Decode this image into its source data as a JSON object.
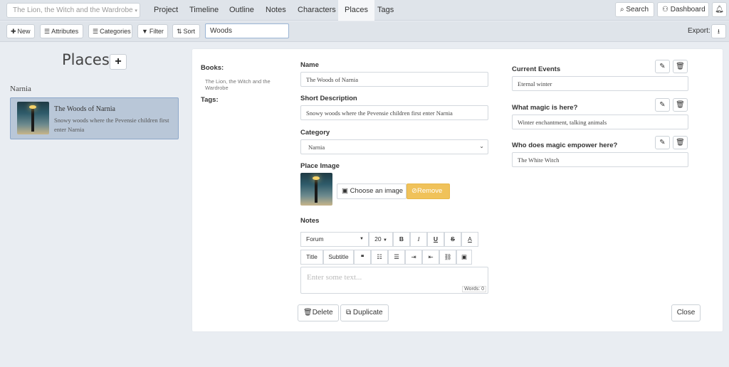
{
  "top_nav": {
    "project_select": "The Lion, the Witch and the Wardrobe",
    "tabs": [
      "Project",
      "Timeline",
      "Outline",
      "Notes",
      "Characters",
      "Places",
      "Tags"
    ],
    "active_tab": "Places",
    "search_label": "Search",
    "dashboard_label": "Dashboard"
  },
  "toolbar": {
    "new_label": "New",
    "attributes_label": "Attributes",
    "categories_label": "Categories",
    "filter_label": "Filter",
    "sort_label": "Sort",
    "search_value": "Woods",
    "export_label": "Export:"
  },
  "sidebar": {
    "title": "Places",
    "group": "Narnia",
    "items": [
      {
        "title": "The Woods of Narnia",
        "description": "Snowy woods where the Pevensie children first enter Narnia"
      }
    ]
  },
  "detail": {
    "books_label": "Books:",
    "books_value": "The Lion, the Witch and the Wardrobe",
    "tags_label": "Tags:",
    "name_label": "Name",
    "name_value": "The Woods of Narnia",
    "short_desc_label": "Short Description",
    "short_desc_value": "Snowy woods where the Pevensie children first enter Narnia",
    "category_label": "Category",
    "category_value": "Narnia",
    "place_image_label": "Place Image",
    "choose_image_label": "Choose an image",
    "remove_label": "Remove",
    "notes_label": "Notes",
    "editor": {
      "font": "Forum",
      "size": "20",
      "title_btn": "Title",
      "subtitle_btn": "Subtitle",
      "placeholder": "Enter some text...",
      "word_count": "Words: 0"
    },
    "delete_label": "Delete",
    "duplicate_label": "Duplicate",
    "close_label": "Close"
  },
  "attributes": [
    {
      "label": "Current Events",
      "value": "Eternal winter"
    },
    {
      "label": "What magic is here?",
      "value": "Winter enchantment, talking animals"
    },
    {
      "label": "Who does magic empower here?",
      "value": "The White Witch"
    }
  ],
  "colors": {
    "selected_item_bg": "#b9c7d8",
    "remove_button": "#f0c25a",
    "toolbar_bg": "#dfe4ea"
  }
}
